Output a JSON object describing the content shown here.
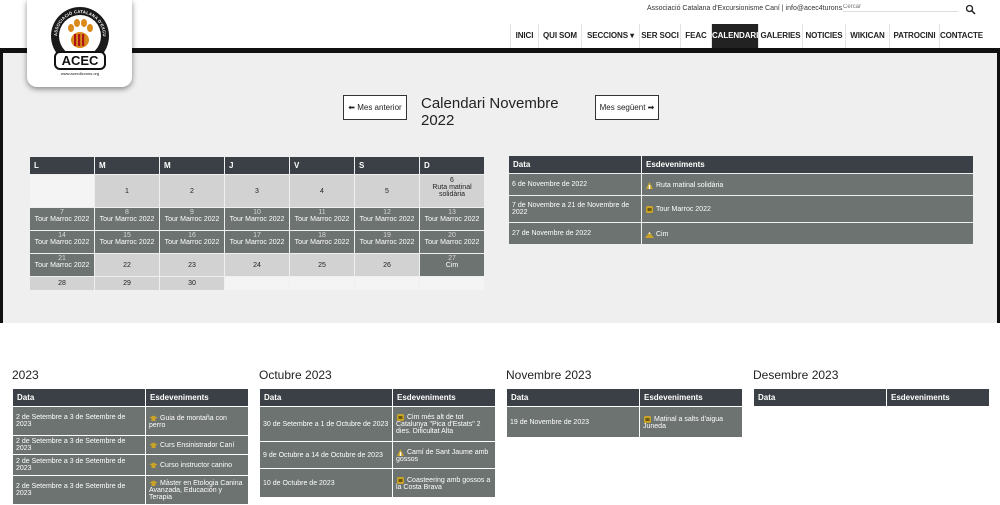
{
  "header": {
    "contact": "Associació Catalana d'Excursionisme Caní | info@acec4turons.org",
    "search_placeholder": "Cercar",
    "logo": {
      "text": "ACEC",
      "ring_text": "ASSOCIACIÓ CATALANA D'EXCURSIONISME CANÍ",
      "url_text": "www.acec4turons.org"
    }
  },
  "nav": {
    "items": [
      {
        "label": "INICI",
        "active": false
      },
      {
        "label": "QUI SOM",
        "active": false
      },
      {
        "label": "SECCIONS",
        "active": false,
        "dropdown": true
      },
      {
        "label": "SER SOCI",
        "active": false
      },
      {
        "label": "FEAC",
        "active": false
      },
      {
        "label": "CALENDARI",
        "active": true
      },
      {
        "label": "GALERIES",
        "active": false
      },
      {
        "label": "NOTICIES",
        "active": false
      },
      {
        "label": "WIKICAN",
        "active": false
      },
      {
        "label": "PATROCINI",
        "active": false
      },
      {
        "label": "CONTACTE",
        "active": false
      }
    ]
  },
  "calendar": {
    "prev_label": "⬅ Mes anterior",
    "next_label": "Mes següent ➡",
    "title": "Calendari Novembre 2022",
    "weekdays": [
      "L",
      "M",
      "M",
      "J",
      "V",
      "S",
      "D"
    ],
    "weeks": [
      [
        {
          "day": "",
          "type": "empty"
        },
        {
          "day": "1",
          "type": "day"
        },
        {
          "day": "2",
          "type": "day"
        },
        {
          "day": "3",
          "type": "day"
        },
        {
          "day": "4",
          "type": "day"
        },
        {
          "day": "5",
          "type": "day"
        },
        {
          "day": "6",
          "type": "day",
          "event": "Ruta matinal solidària"
        }
      ],
      [
        {
          "day": "7",
          "type": "event",
          "event": "Tour Marroc 2022"
        },
        {
          "day": "8",
          "type": "event",
          "event": "Tour Marroc 2022"
        },
        {
          "day": "9",
          "type": "event",
          "event": "Tour Marroc 2022"
        },
        {
          "day": "10",
          "type": "event",
          "event": "Tour Marroc 2022"
        },
        {
          "day": "11",
          "type": "event",
          "event": "Tour Marroc 2022"
        },
        {
          "day": "12",
          "type": "event",
          "event": "Tour Marroc 2022"
        },
        {
          "day": "13",
          "type": "event",
          "event": "Tour Marroc 2022"
        }
      ],
      [
        {
          "day": "14",
          "type": "event",
          "event": "Tour Marroc 2022"
        },
        {
          "day": "15",
          "type": "event",
          "event": "Tour Marroc 2022"
        },
        {
          "day": "16",
          "type": "event",
          "event": "Tour Marroc 2022"
        },
        {
          "day": "17",
          "type": "event",
          "event": "Tour Marroc 2022"
        },
        {
          "day": "18",
          "type": "event",
          "event": "Tour Marroc 2022"
        },
        {
          "day": "19",
          "type": "event",
          "event": "Tour Marroc 2022"
        },
        {
          "day": "20",
          "type": "event",
          "event": "Tour Marroc 2022"
        }
      ],
      [
        {
          "day": "21",
          "type": "event",
          "event": "Tour Marroc 2022"
        },
        {
          "day": "22",
          "type": "day"
        },
        {
          "day": "23",
          "type": "day"
        },
        {
          "day": "24",
          "type": "day"
        },
        {
          "day": "25",
          "type": "day"
        },
        {
          "day": "26",
          "type": "day"
        },
        {
          "day": "27",
          "type": "event",
          "event": "Cim"
        }
      ],
      [
        {
          "day": "28",
          "type": "day"
        },
        {
          "day": "29",
          "type": "day"
        },
        {
          "day": "30",
          "type": "day"
        },
        {
          "day": "",
          "type": "empty"
        },
        {
          "day": "",
          "type": "empty"
        },
        {
          "day": "",
          "type": "empty"
        },
        {
          "day": "",
          "type": "empty"
        }
      ]
    ]
  },
  "events_2022": {
    "headers": [
      "Data",
      "Esdeveniments"
    ],
    "rows": [
      {
        "date": "6 de Novembre de 2022",
        "event": "Ruta matinal solidària",
        "icon": "hiker-icon"
      },
      {
        "date": "7 de Novembre a 21 de Novembre de 2022",
        "event": "Tour Marroc 2022",
        "icon": "backpack-icon"
      },
      {
        "date": "27 de Novembre de 2022",
        "event": "Cim",
        "icon": "mountain-icon"
      }
    ]
  },
  "months": [
    {
      "title": "2023",
      "headers": [
        "Data",
        "Esdeveniments"
      ],
      "rows": [
        {
          "date": "2 de Setembre a 3 de Setembre de 2023",
          "event": "Guia de montaña con perro",
          "icon": "graduation-cap-icon"
        },
        {
          "date": "2 de Setembre a 3 de Setembre de 2023",
          "event": "Curs Ensinistrador Caní",
          "icon": "graduation-cap-icon"
        },
        {
          "date": "2 de Setembre a 3 de Setembre de 2023",
          "event": "Curso instructor canino",
          "icon": "graduation-cap-icon"
        },
        {
          "date": "2 de Setembre a 3 de Setembre de 2023",
          "event": "Màster en Etologia Canina Avanzada, Educación y Terapia",
          "icon": "graduation-cap-icon"
        }
      ]
    },
    {
      "title": "Octubre 2023",
      "headers": [
        "Data",
        "Esdeveniments"
      ],
      "rows": [
        {
          "date": "30 de Setembre a 1 de Octubre de 2023",
          "event": "Cim més alt de tot Catalunya \"Pica d'Estats\" 2 dies. Dificultat Alta",
          "icon": "backpack-icon"
        },
        {
          "date": "9 de Octubre a 14 de Octubre de 2023",
          "event": "Camí de Sant Jaume amb gossos",
          "icon": "hiker-icon"
        },
        {
          "date": "10 de Octubre de 2023",
          "event": "Coasteering amb gossos a la Costa Brava",
          "icon": "backpack-icon"
        }
      ]
    },
    {
      "title": "Novembre 2023",
      "headers": [
        "Data",
        "Esdeveniments"
      ],
      "rows": [
        {
          "date": "19 de Novembre de 2023",
          "event": "Matinal a salts d'aigua Juneda",
          "icon": "backpack-icon"
        }
      ]
    },
    {
      "title": "Desembre 2023",
      "headers": [
        "Data",
        "Esdeveniments"
      ],
      "rows": []
    }
  ],
  "colors": {
    "header_dark": "#3a4045",
    "event_cell": "#6c7370",
    "day_cell": "#d2d2d2",
    "icon_gold": "#c9a227"
  }
}
